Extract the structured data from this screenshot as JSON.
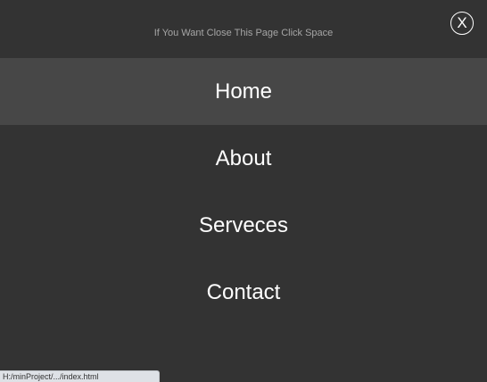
{
  "header": {
    "hint_text": "If You Want Close This Page Click Space",
    "close_label": "X"
  },
  "nav": {
    "items": [
      {
        "label": "Home",
        "active": true
      },
      {
        "label": "About",
        "active": false
      },
      {
        "label": "Serveces",
        "active": false
      },
      {
        "label": "Contact",
        "active": false
      }
    ]
  },
  "status_bar": {
    "url": "H:/minProject/.../index.html"
  },
  "colors": {
    "background": "#333333",
    "active_item": "#474747",
    "text": "#ffffff",
    "hint": "#a6a6a6"
  }
}
